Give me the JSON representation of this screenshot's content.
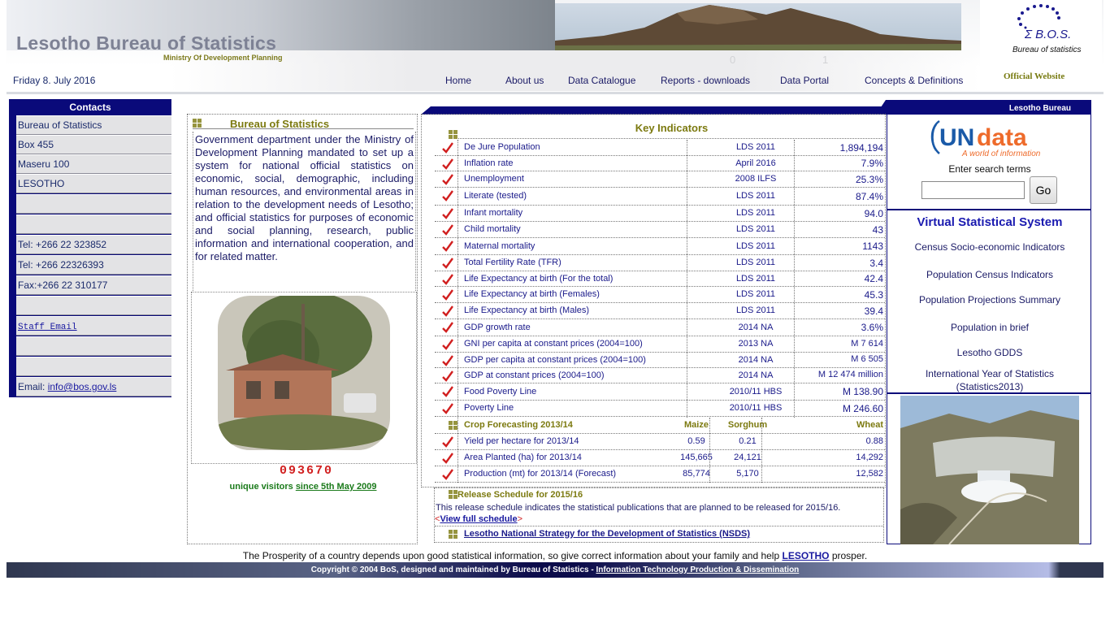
{
  "header": {
    "title": "Lesotho Bureau of Statistics",
    "subtitle": "Ministry Of Development Planning",
    "date": "Friday 8. July 2016",
    "logo_text": "Σ B.O.S.",
    "logo_sub": "Bureau of statistics",
    "official": "Official Website",
    "faint_digits": [
      "0",
      "1"
    ]
  },
  "nav": [
    "Home",
    "About us",
    "Data Catalogue",
    "Reports - downloads",
    "Data Portal",
    "Concepts & Definitions"
  ],
  "contacts": {
    "title": "Contacts",
    "rows": [
      "Bureau of Statistics",
      "Box 455",
      "Maseru 100",
      "LESOTHO",
      "",
      "",
      "Tel: +266 22 323852",
      "Tel: +266 22326393",
      "Fax:+266 22 310177",
      "",
      "Staff Email",
      "",
      ""
    ],
    "email_label": "Email: ",
    "email_link": "info@bos.gov.ls"
  },
  "bos": {
    "title": "Bureau of Statistics",
    "description": "Government department under the Ministry of Development Planning mandated to set up a system for national official statistics on economic, social, demographic, including human resources, and environmental areas in relation to the development needs of Lesotho; and official statistics for purposes of economic and social planning, research, public information and international cooperation, and for related matter.",
    "visitor_count": "093670",
    "visitors_label": "unique visitors ",
    "visitors_since": "since 5th May 2009"
  },
  "key_indicators": {
    "bar_label": "Lesotho Bureau",
    "title": "Key Indicators",
    "rows": [
      {
        "name": "De Jure Population",
        "source": "LDS 2011",
        "value": "1,894,194"
      },
      {
        "name": "Inflation rate",
        "source": "April 2016",
        "value": "7.9%"
      },
      {
        "name": "Unemployment",
        "source": "2008 ILFS",
        "value": "25.3%"
      },
      {
        "name": "Literate (tested)",
        "source": "LDS 2011",
        "value": "87.4%"
      },
      {
        "name": "Infant mortality",
        "source": "LDS 2011",
        "value": "94.0"
      },
      {
        "name": "Child mortality",
        "source": "LDS 2011",
        "value": "43"
      },
      {
        "name": "Maternal mortality",
        "source": "LDS 2011",
        "value": "1143"
      },
      {
        "name": "Total Fertility Rate (TFR)",
        "source": "LDS 2011",
        "value": "3.4"
      },
      {
        "name": "Life Expectancy at birth (For the total)",
        "source": "LDS 2011",
        "value": "42.4"
      },
      {
        "name": "Life Expectancy at birth (Females)",
        "source": "LDS 2011",
        "value": "45.3"
      },
      {
        "name": "Life Expectancy at birth (Males)",
        "source": "LDS 2011",
        "value": "39.4"
      },
      {
        "name": "GDP growth rate",
        "source": "2014 NA",
        "value": "3.6%"
      },
      {
        "name": "GNI per capita at constant prices (2004=100)",
        "source": "2013 NA",
        "value": "M 7 614"
      },
      {
        "name": "GDP per capita at constant prices (2004=100)",
        "source": "2014 NA",
        "value": "M 6 505"
      },
      {
        "name": "GDP at constant prices (2004=100)",
        "source": "2014 NA",
        "value": "M 12 474 million"
      },
      {
        "name": "Food Poverty Line",
        "source": "2010/11 HBS",
        "value": "M 138.90"
      },
      {
        "name": "Poverty Line",
        "source": "2010/11 HBS",
        "value": "M 246.60"
      }
    ],
    "crop": {
      "title": "Crop Forecasting 2013/14",
      "columns": [
        "Maize",
        "Sorghum",
        "Wheat"
      ],
      "rows": [
        {
          "name": "Yield per hectare for 2013/14",
          "values": [
            "0.59",
            "0.21",
            "0.88"
          ]
        },
        {
          "name": "Area Planted (ha) for 2013/14",
          "values": [
            "145,665",
            "24,121",
            "14,292"
          ]
        },
        {
          "name": "Production (mt) for 2013/14 (Forecast)",
          "values": [
            "85,774",
            "5,170",
            "12,582"
          ]
        }
      ]
    },
    "release": {
      "title": "Release Schedule for 2015/16",
      "text": "This release schedule indicates the statistical publications that are planned to be released for 2015/16.",
      "link": "View full schedule"
    },
    "nsds": "Lesotho National Strategy for the Development of Statistics (NSDS)"
  },
  "right": {
    "undata": "UNdata",
    "undata_tag": "A world of information",
    "search_label": "Enter search terms",
    "search_placeholder": "",
    "go": "Go",
    "vss_title": "Virtual Statistical System",
    "vss_links": [
      "Census Socio-economic Indicators",
      "Population Census Indicators",
      "Population Projections Summary",
      "Population in brief",
      "Lesotho GDDS",
      "International Year of Statistics (Statistics2013)"
    ]
  },
  "footer": {
    "tagline_pre": "The Prosperity of a country depends upon good statistical information, so give correct information about your family and help ",
    "tagline_link": "LESOTHO",
    "tagline_post": " prosper.",
    "copyright": "Copyright © 2004 BoS, designed and maintained by Bureau of Statistics - ",
    "copyright_link": "Information Technology Production & Dissemination"
  },
  "colors": {
    "navy": "#0a0a7a",
    "olive": "#7c7a10",
    "check_red": "#d11f1f"
  }
}
